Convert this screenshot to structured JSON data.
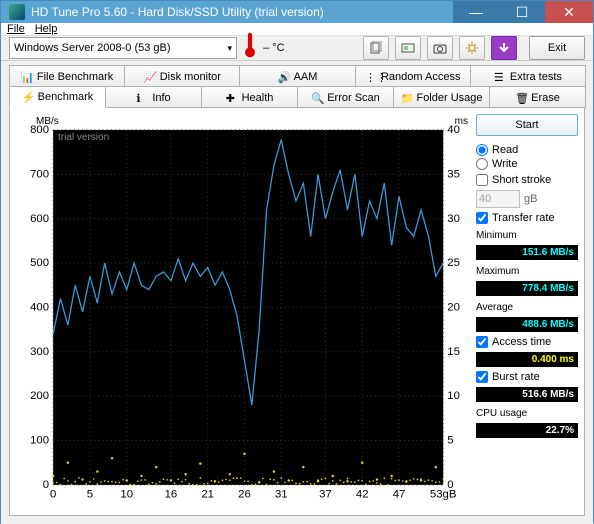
{
  "window": {
    "title": "HD Tune Pro 5.60 - Hard Disk/SSD Utility (trial version)"
  },
  "menu": {
    "file": "File",
    "help": "Help"
  },
  "toolbar": {
    "drive": "Windows Server 2008-0 (53 gB)",
    "temp": "– °C",
    "exit": "Exit"
  },
  "tabs_row1": [
    {
      "label": "File Benchmark"
    },
    {
      "label": "Disk monitor"
    },
    {
      "label": "AAM"
    },
    {
      "label": "Random Access"
    },
    {
      "label": "Extra tests"
    }
  ],
  "tabs_row2": [
    {
      "label": "Benchmark",
      "active": true
    },
    {
      "label": "Info"
    },
    {
      "label": "Health"
    },
    {
      "label": "Error Scan"
    },
    {
      "label": "Folder Usage"
    },
    {
      "label": "Erase"
    }
  ],
  "side": {
    "start": "Start",
    "read": "Read",
    "write": "Write",
    "short_stroke": "Short stroke",
    "stroke_value": "40",
    "stroke_unit": "gB",
    "transfer_rate": "Transfer rate",
    "min_label": "Minimum",
    "min_val": "151.6 MB/s",
    "max_label": "Maximum",
    "max_val": "778.4 MB/s",
    "avg_label": "Average",
    "avg_val": "488.6 MB/s",
    "access_label": "Access time",
    "access_val": "0.400 ms",
    "burst_label": "Burst rate",
    "burst_val": "516.6 MB/s",
    "cpu_label": "CPU usage",
    "cpu_val": "22.7%"
  },
  "chart_data": {
    "type": "line",
    "title": "",
    "xlabel": "gB",
    "ylabel_left": "MB/s",
    "ylabel_right": "ms",
    "xlim": [
      0,
      53
    ],
    "ylim_left": [
      0,
      800
    ],
    "ylim_right": [
      0,
      40
    ],
    "x_ticks": [
      0,
      5,
      10,
      16,
      21,
      26,
      31,
      37,
      42,
      47,
      53
    ],
    "y_ticks_left": [
      0,
      100,
      200,
      300,
      400,
      500,
      600,
      700,
      800
    ],
    "y_ticks_right": [
      0,
      5,
      10,
      15,
      20,
      25,
      30,
      35,
      40
    ],
    "x_unit_label": "53gB",
    "trial_text": "trial version",
    "series": [
      {
        "name": "Transfer rate (MB/s)",
        "color": "#39a0e0",
        "axis": "left",
        "x": [
          0,
          1,
          2,
          3,
          4,
          5,
          6,
          7,
          8,
          9,
          10,
          11,
          12,
          13,
          14,
          15,
          16,
          17,
          18,
          19,
          20,
          21,
          22,
          23,
          24,
          25,
          26,
          27,
          28,
          29,
          30,
          31,
          32,
          33,
          34,
          35,
          36,
          37,
          38,
          39,
          40,
          41,
          42,
          43,
          44,
          45,
          46,
          47,
          48,
          49,
          50,
          51,
          52,
          53
        ],
        "values": [
          340,
          420,
          360,
          450,
          390,
          470,
          410,
          500,
          430,
          480,
          440,
          500,
          450,
          440,
          470,
          480,
          460,
          510,
          460,
          500,
          470,
          490,
          450,
          480,
          440,
          380,
          280,
          180,
          350,
          620,
          720,
          778,
          700,
          640,
          680,
          560,
          700,
          600,
          660,
          710,
          620,
          700,
          560,
          640,
          600,
          680,
          540,
          650,
          580,
          560,
          620,
          560,
          470,
          500
        ]
      },
      {
        "name": "Access time (ms)",
        "color": "#e0e000",
        "axis": "right",
        "type": "scatter",
        "x": [
          0,
          2,
          4,
          6,
          8,
          10,
          12,
          14,
          16,
          18,
          20,
          22,
          24,
          26,
          28,
          30,
          32,
          34,
          36,
          38,
          40,
          42,
          44,
          46,
          48,
          50,
          52
        ],
        "values": [
          1.0,
          2.5,
          0.6,
          1.5,
          3.0,
          0.5,
          1.0,
          2.0,
          0.5,
          1.2,
          2.4,
          0.4,
          1.2,
          3.5,
          0.3,
          1.5,
          0.5,
          2.0,
          0.4,
          1.0,
          0.4,
          2.5,
          0.6,
          1.0,
          0.4,
          0.5,
          2.0
        ]
      }
    ]
  }
}
